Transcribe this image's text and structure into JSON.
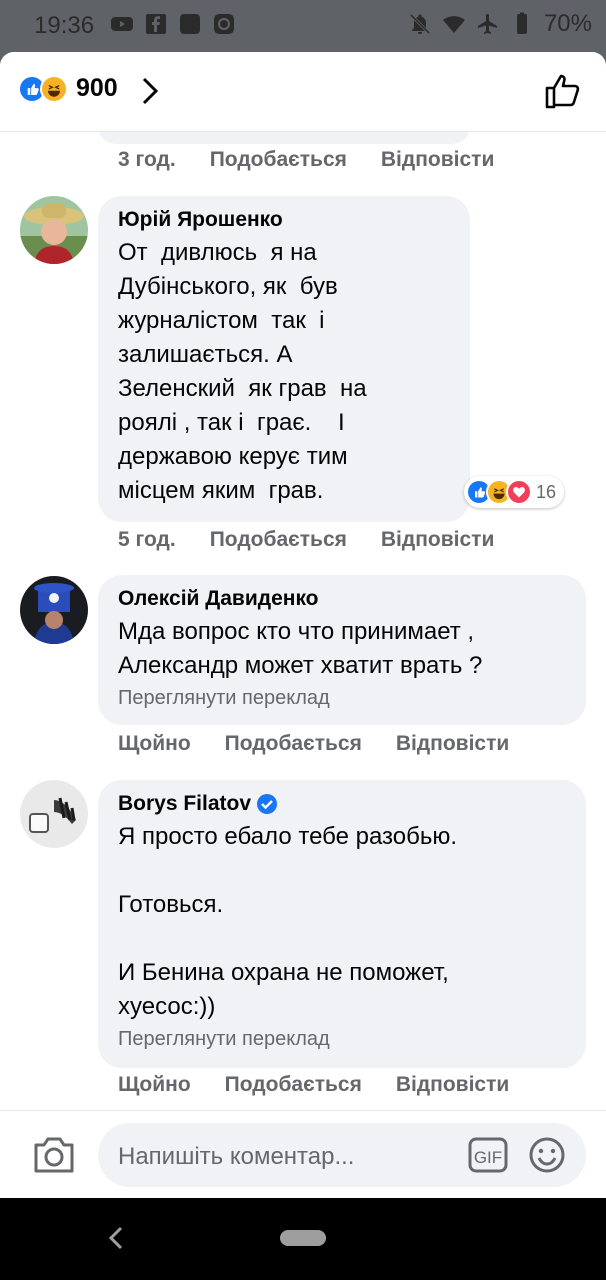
{
  "status_bar": {
    "time": "19:36",
    "battery": "70%"
  },
  "reactions_header": {
    "count": "900"
  },
  "comments": [
    {
      "actions": {
        "time": "3 год.",
        "like": "Подобається",
        "reply": "Відповісти"
      }
    },
    {
      "author": "Юрій Ярошенко",
      "text": "От  дивлюсь  я на\nДубінського, як  був\nжурналістом  так  і\nзалишається. А\nЗеленский  як грав  на\nроялі , так і  грає.    І\nдержавою керує тим\nмісцем яким  грав.",
      "reactions_count": "16",
      "actions": {
        "time": "5 год.",
        "like": "Подобається",
        "reply": "Відповісти"
      }
    },
    {
      "author": "Олексій Давиденко",
      "text": "Мда вопрос кто что принимает ,\nАлександр может хватит врать ?",
      "translate": "Переглянути переклад",
      "actions": {
        "time": "Щойно",
        "like": "Подобається",
        "reply": "Відповісти"
      }
    },
    {
      "author": "Borys Filatov",
      "verified": true,
      "text": "Я просто ебало тебе разобью.\n\nГотовься.\n\nИ Бенина охрана не поможет,\nхуесос:))",
      "translate": "Переглянути переклад",
      "actions": {
        "time": "Щойно",
        "like": "Подобається",
        "reply": "Відповісти"
      }
    }
  ],
  "composer": {
    "placeholder": "Напишіть коментар...",
    "gif_label": "GIF"
  },
  "colors": {
    "facebook_blue": "#1877f2",
    "bubble": "#f0f2f5",
    "secondary_text": "#65676b"
  }
}
